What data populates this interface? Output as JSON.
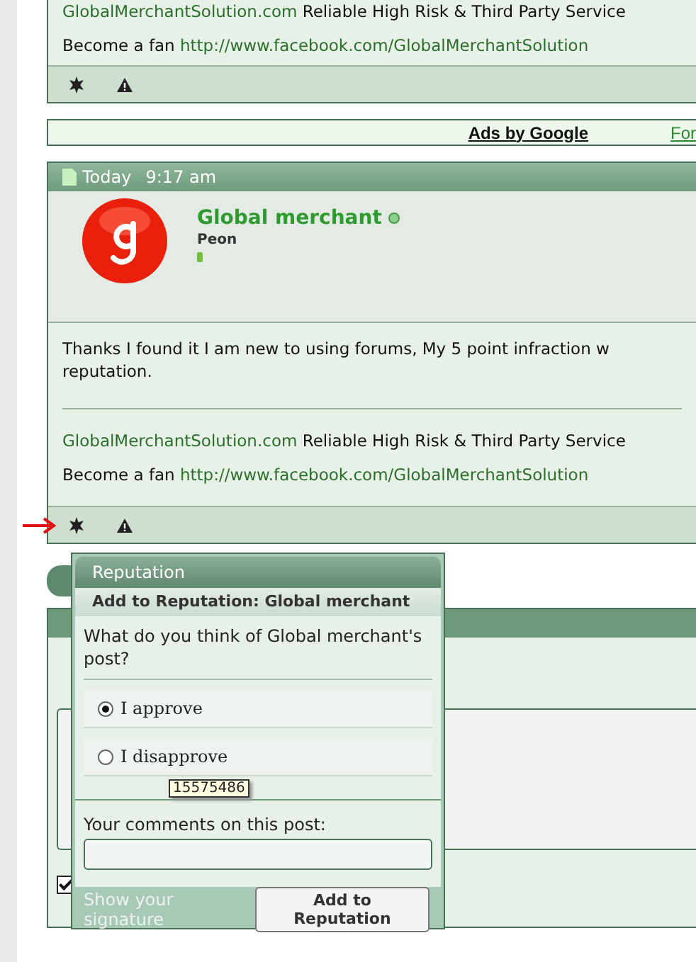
{
  "top_post": {
    "signature": {
      "link": "GlobalMerchantSolution.com",
      "text": " Reliable High Risk & Third Party Service"
    },
    "fan": {
      "text": "Become a fan ",
      "link": "http://www.facebook.com/GlobalMerchantSolution"
    }
  },
  "ads_bar": {
    "label": "Ads by Google",
    "link": "For"
  },
  "post": {
    "date": "Today",
    "time": "9:17 am",
    "username": "Global merchant",
    "online": true,
    "rank": "Peon",
    "message": "Thanks I found it I am new to using forums, My 5 point infraction w\nreputation.",
    "signature": {
      "link": "GlobalMerchantSolution.com",
      "text": " Reliable High Risk & Third Party Service"
    },
    "fan": {
      "text": "Become a fan ",
      "link": "http://www.facebook.com/GlobalMerchantSolution"
    }
  },
  "editor": {
    "show_signature": {
      "label": "Show your signature",
      "checked": true
    }
  },
  "reputation_popup": {
    "title": "Reputation",
    "subtitle": "Add to Reputation: Global merchant",
    "question": "What do you think of Global merchant's post?",
    "options": [
      {
        "label": "I approve",
        "selected": true
      },
      {
        "label": "I disapprove",
        "selected": false
      }
    ],
    "tooltip": "15575486",
    "comment_label": "Your comments on this post:",
    "submit": "Add to Reputation"
  }
}
